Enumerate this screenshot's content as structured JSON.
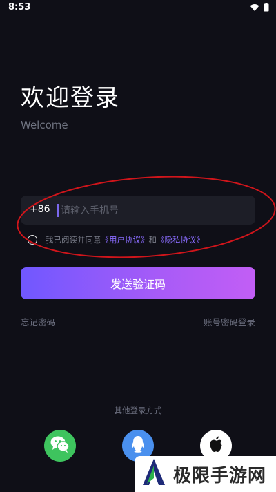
{
  "status_bar": {
    "time": "8:53",
    "icons": [
      "wifi-icon",
      "battery-icon"
    ]
  },
  "header": {
    "title": "欢迎登录",
    "subtitle": "Welcome"
  },
  "phone": {
    "country_code": "+86",
    "placeholder": "请输入手机号",
    "value": ""
  },
  "agreement": {
    "prefix": "我已阅读并同意",
    "user_agreement": "《用户协议》",
    "and": "和",
    "privacy_agreement": "《隐私协议》",
    "checked": false
  },
  "actions": {
    "send_code": "发送验证码",
    "forgot_password": "忘记密码",
    "password_login": "账号密码登录"
  },
  "other_login": {
    "label": "其他登录方式",
    "providers": [
      "wechat-icon",
      "qq-icon",
      "apple-icon"
    ]
  },
  "watermark": {
    "text": "极限手游网"
  },
  "colors": {
    "background": "#0f0f17",
    "accent": "#7b68ee",
    "link": "#8a6cff",
    "button_gradient_start": "#7058ff",
    "button_gradient_end": "#c25ef5",
    "annotation": "#d0151b"
  }
}
